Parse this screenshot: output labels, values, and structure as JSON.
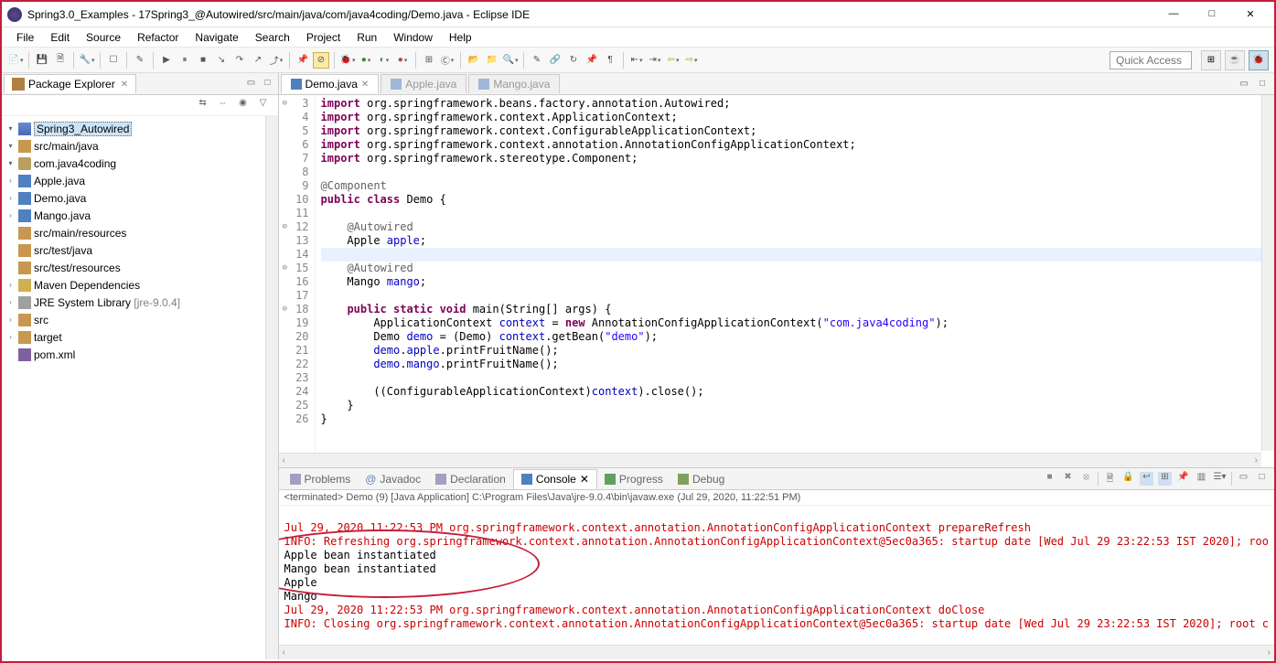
{
  "window": {
    "title": "Spring3.0_Examples - 17Spring3_@Autowired/src/main/java/com/java4coding/Demo.java - Eclipse IDE"
  },
  "menu": [
    "File",
    "Edit",
    "Source",
    "Refactor",
    "Navigate",
    "Search",
    "Project",
    "Run",
    "Window",
    "Help"
  ],
  "quickAccess": "Quick Access",
  "packageExplorer": {
    "title": "Package Explorer",
    "project": "Spring3_Autowired",
    "srcMainJava": "src/main/java",
    "pkg": "com.java4coding",
    "files": [
      "Apple.java",
      "Demo.java",
      "Mango.java"
    ],
    "srcMainRes": "src/main/resources",
    "srcTestJava": "src/test/java",
    "srcTestRes": "src/test/resources",
    "mavenDeps": "Maven Dependencies",
    "jre": "JRE System Library",
    "jreVer": "[jre-9.0.4]",
    "src": "src",
    "target": "target",
    "pom": "pom.xml"
  },
  "editorTabs": {
    "active": "Demo.java",
    "inactive1": "Apple.java",
    "inactive2": "Mango.java"
  },
  "code": {
    "l3": "import org.springframework.beans.factory.annotation.Autowired;",
    "l4": "import org.springframework.context.ApplicationContext;",
    "l5": "import org.springframework.context.ConfigurableApplicationContext;",
    "l6": "import org.springframework.context.annotation.AnnotationConfigApplicationContext;",
    "l7": "import org.springframework.stereotype.Component;",
    "l9": "@Component",
    "l10a": "public class",
    "l10b": " Demo {",
    "l12": "    @Autowired",
    "l13a": "    Apple ",
    "l13b": "apple",
    "l13c": ";",
    "l15": "    @Autowired",
    "l16a": "    Mango ",
    "l16b": "mango",
    "l16c": ";",
    "l18a": "    public static void",
    "l18b": " main(String[] args) {",
    "l19a": "        ApplicationContext ",
    "l19b": "context",
    "l19c": " = ",
    "l19d": "new",
    "l19e": " AnnotationConfigApplicationContext(",
    "l19f": "\"com.java4coding\"",
    "l19g": ");",
    "l20a": "        Demo ",
    "l20b": "demo",
    "l20c": " = (Demo) ",
    "l20d": "context",
    "l20e": ".getBean(",
    "l20f": "\"demo\"",
    "l20g": ");",
    "l21a": "        ",
    "l21b": "demo",
    "l21c": ".",
    "l21d": "apple",
    "l21e": ".printFruitName();",
    "l22a": "        ",
    "l22b": "demo",
    "l22c": ".",
    "l22d": "mango",
    "l22e": ".printFruitName();",
    "l24a": "        ((ConfigurableApplicationContext)",
    "l24b": "context",
    "l24c": ").close();",
    "l25": "    }",
    "l26": "}"
  },
  "bottomTabs": {
    "problems": "Problems",
    "javadoc": "Javadoc",
    "declaration": "Declaration",
    "console": "Console",
    "progress": "Progress",
    "debug": "Debug"
  },
  "consoleHead": "<terminated> Demo (9) [Java Application] C:\\Program Files\\Java\\jre-9.0.4\\bin\\javaw.exe (Jul 29, 2020, 11:22:51 PM)",
  "console": {
    "r1": "Jul 29, 2020 11:22:53 PM org.springframework.context.annotation.AnnotationConfigApplicationContext prepareRefresh",
    "r2": "INFO: Refreshing org.springframework.context.annotation.AnnotationConfigApplicationContext@5ec0a365: startup date [Wed Jul 29 23:22:53 IST 2020]; roo",
    "b1": "Apple bean instantiated",
    "b2": "Mango bean instantiated",
    "b3": "Apple",
    "b4": "Mango",
    "r3": "Jul 29, 2020 11:22:53 PM org.springframework.context.annotation.AnnotationConfigApplicationContext doClose",
    "r4": "INFO: Closing org.springframework.context.annotation.AnnotationConfigApplicationContext@5ec0a365: startup date [Wed Jul 29 23:22:53 IST 2020]; root c"
  }
}
